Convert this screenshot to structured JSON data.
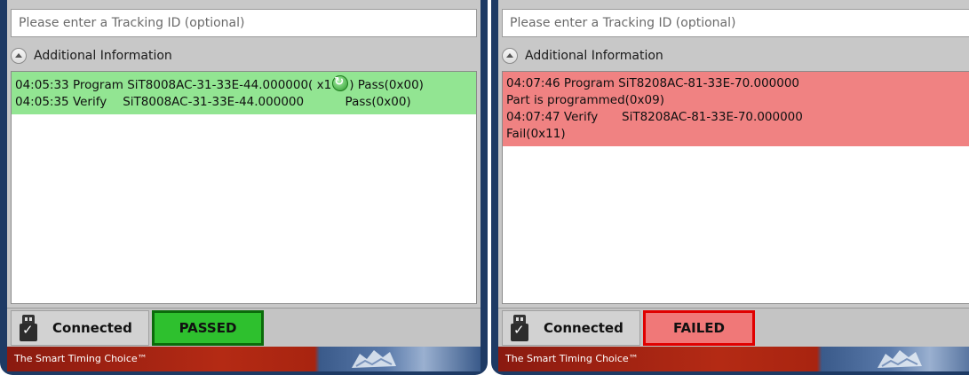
{
  "panels": {
    "left": {
      "tracking_placeholder": "Please enter a Tracking ID (optional)",
      "info_label": "Additional Information",
      "log_lines": [
        {
          "time": "04:05:33",
          "action": "Program",
          "part": "SiT8008AC-31-33E-44.000000( x1",
          "suffix": ") Pass(0x00)"
        },
        {
          "time": "04:05:35",
          "action": "Verify",
          "part": "SiT8008AC-31-33E-44.000000",
          "result": "Pass(0x00)"
        }
      ],
      "connection": "Connected",
      "result": "PASSED",
      "footer": "The Smart Timing Choice™"
    },
    "right": {
      "tracking_placeholder": "Please enter a Tracking ID (optional)",
      "info_label": "Additional Information",
      "log_lines": [
        "04:07:46 Program SiT8208AC-81-33E-70.000000",
        "Part is programmed(0x09)",
        "04:07:47 Verify",
        "SiT8208AC-81-33E-70.000000",
        "Fail(0x11)"
      ],
      "connection": "Connected",
      "result": "FAILED",
      "footer": "The Smart Timing Choice™"
    }
  },
  "colors": {
    "pass_log_bg": "#92e592",
    "fail_log_bg": "#f08282",
    "pass_button": "#2ec02e",
    "fail_button": "#f07878",
    "frame": "#1e3a64"
  },
  "icons": [
    "collapse-up-icon",
    "sync-icon",
    "usb-connected-icon",
    "globe-icon"
  ]
}
